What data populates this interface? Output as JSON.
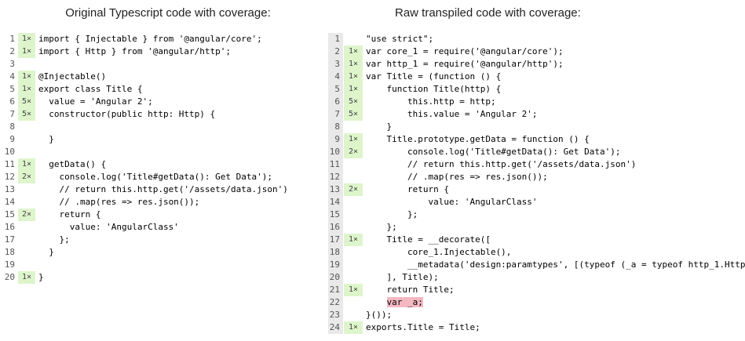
{
  "left": {
    "title": "Original Typescript code with coverage:",
    "lines": [
      {
        "n": "1",
        "hits": "1×",
        "state": "hit",
        "code": "import { Injectable } from '@angular/core';"
      },
      {
        "n": "2",
        "hits": "1×",
        "state": "hit",
        "code": "import { Http } from '@angular/http';"
      },
      {
        "n": "3",
        "hits": "",
        "state": "neutral",
        "code": ""
      },
      {
        "n": "4",
        "hits": "1×",
        "state": "hit",
        "code": "@Injectable()"
      },
      {
        "n": "5",
        "hits": "1×",
        "state": "hit",
        "code": "export class Title {"
      },
      {
        "n": "6",
        "hits": "5×",
        "state": "hit",
        "code": "  value = 'Angular 2';"
      },
      {
        "n": "7",
        "hits": "5×",
        "state": "hit",
        "code": "  constructor(public http: Http) {"
      },
      {
        "n": "8",
        "hits": "",
        "state": "neutral",
        "code": ""
      },
      {
        "n": "9",
        "hits": "",
        "state": "neutral",
        "code": "  }"
      },
      {
        "n": "10",
        "hits": "",
        "state": "neutral",
        "code": ""
      },
      {
        "n": "11",
        "hits": "1×",
        "state": "hit",
        "code": "  getData() {"
      },
      {
        "n": "12",
        "hits": "2×",
        "state": "hit",
        "code": "    console.log('Title#getData(): Get Data');"
      },
      {
        "n": "13",
        "hits": "",
        "state": "neutral",
        "code": "    // return this.http.get('/assets/data.json')"
      },
      {
        "n": "14",
        "hits": "",
        "state": "neutral",
        "code": "    // .map(res => res.json());"
      },
      {
        "n": "15",
        "hits": "2×",
        "state": "hit",
        "code": "    return {"
      },
      {
        "n": "16",
        "hits": "",
        "state": "neutral",
        "code": "      value: 'AngularClass'"
      },
      {
        "n": "17",
        "hits": "",
        "state": "neutral",
        "code": "    };"
      },
      {
        "n": "18",
        "hits": "",
        "state": "neutral",
        "code": "  }"
      },
      {
        "n": "19",
        "hits": "",
        "state": "neutral",
        "code": ""
      },
      {
        "n": "20",
        "hits": "1×",
        "state": "hit",
        "code": "}"
      }
    ]
  },
  "right": {
    "title": "Raw transpiled code with coverage:",
    "lines": [
      {
        "n": "1",
        "hits": "",
        "state": "neutral",
        "code": "\"use strict\";"
      },
      {
        "n": "2",
        "hits": "1×",
        "state": "hit",
        "code": "var core_1 = require('@angular/core');"
      },
      {
        "n": "3",
        "hits": "1×",
        "state": "hit",
        "code": "var http_1 = require('@angular/http');"
      },
      {
        "n": "4",
        "hits": "1×",
        "state": "hit",
        "code": "var Title = (function () {"
      },
      {
        "n": "5",
        "hits": "1×",
        "state": "hit",
        "code": "    function Title(http) {"
      },
      {
        "n": "6",
        "hits": "5×",
        "state": "hit",
        "code": "        this.http = http;"
      },
      {
        "n": "7",
        "hits": "5×",
        "state": "hit",
        "code": "        this.value = 'Angular 2';"
      },
      {
        "n": "8",
        "hits": "",
        "state": "neutral",
        "code": "    }"
      },
      {
        "n": "9",
        "hits": "1×",
        "state": "hit",
        "code": "    Title.prototype.getData = function () {"
      },
      {
        "n": "10",
        "hits": "2×",
        "state": "hit",
        "code": "        console.log('Title#getData(): Get Data');"
      },
      {
        "n": "11",
        "hits": "",
        "state": "neutral",
        "code": "        // return this.http.get('/assets/data.json')"
      },
      {
        "n": "12",
        "hits": "",
        "state": "neutral",
        "code": "        // .map(res => res.json());"
      },
      {
        "n": "13",
        "hits": "2×",
        "state": "hit",
        "code": "        return {"
      },
      {
        "n": "14",
        "hits": "",
        "state": "neutral",
        "code": "            value: 'AngularClass'"
      },
      {
        "n": "15",
        "hits": "",
        "state": "neutral",
        "code": "        };"
      },
      {
        "n": "16",
        "hits": "",
        "state": "neutral",
        "code": "    };"
      },
      {
        "n": "17",
        "hits": "1×",
        "state": "hit",
        "code": "    Title = __decorate(["
      },
      {
        "n": "18",
        "hits": "",
        "state": "neutral",
        "code": "        core_1.Injectable(),"
      },
      {
        "n": "19",
        "hits": "",
        "state": "neutral",
        "code": "        __metadata('design:paramtypes', [(typeof (_a = typeof http_1.Http"
      },
      {
        "n": "20",
        "hits": "",
        "state": "neutral",
        "code": "    ], Title);"
      },
      {
        "n": "21",
        "hits": "1×",
        "state": "hit",
        "code": "    return Title;"
      },
      {
        "n": "22",
        "hits": "",
        "state": "miss",
        "code": "    var _a;"
      },
      {
        "n": "23",
        "hits": "",
        "state": "neutral",
        "code": "}());"
      },
      {
        "n": "24",
        "hits": "1×",
        "state": "hit",
        "code": "exports.Title = Title;"
      }
    ]
  },
  "colors": {
    "hit_background": "#def5cc",
    "neutral_background": "#e9e9e9",
    "miss_highlight": "#f4b8c2"
  }
}
